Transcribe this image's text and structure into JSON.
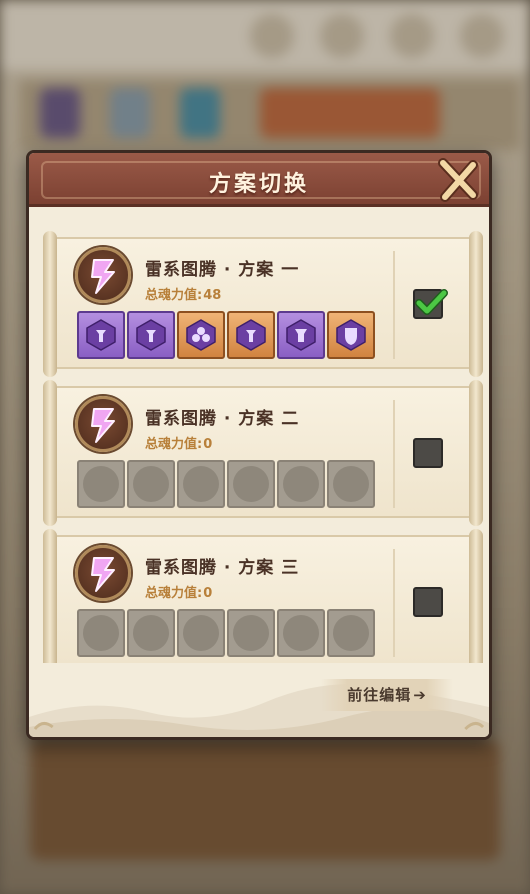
{
  "dialog": {
    "title": "方案切换",
    "goto_edit_label": "前往编辑",
    "goto_edit_arrow": "➔"
  },
  "schemes": [
    {
      "title": "雷系图腾 · 方案 一",
      "power_label": "总魂力值:",
      "power_value": "48",
      "selected": true,
      "slots": [
        "purple",
        "purple",
        "orange",
        "orange",
        "purple",
        "orange"
      ]
    },
    {
      "title": "雷系图腾 · 方案 二",
      "power_label": "总魂力值:",
      "power_value": "0",
      "selected": false,
      "slots": [
        "empty",
        "empty",
        "empty",
        "empty",
        "empty",
        "empty"
      ]
    },
    {
      "title": "雷系图腾 · 方案 三",
      "power_label": "总魂力值:",
      "power_value": "0",
      "selected": false,
      "slots": [
        "empty",
        "empty",
        "empty",
        "empty",
        "empty",
        "empty"
      ]
    }
  ],
  "icons": {
    "emblem": "lightning-bolt-icon",
    "close": "close-x-icon",
    "check": "checkmark-icon"
  },
  "colors": {
    "header": "#8a4b3a",
    "panel": "#f3ecdb",
    "rune_purple": "#9a70d0",
    "rune_orange": "#e09a56",
    "check_green": "#3fb53a",
    "power_text": "#b8803a"
  }
}
